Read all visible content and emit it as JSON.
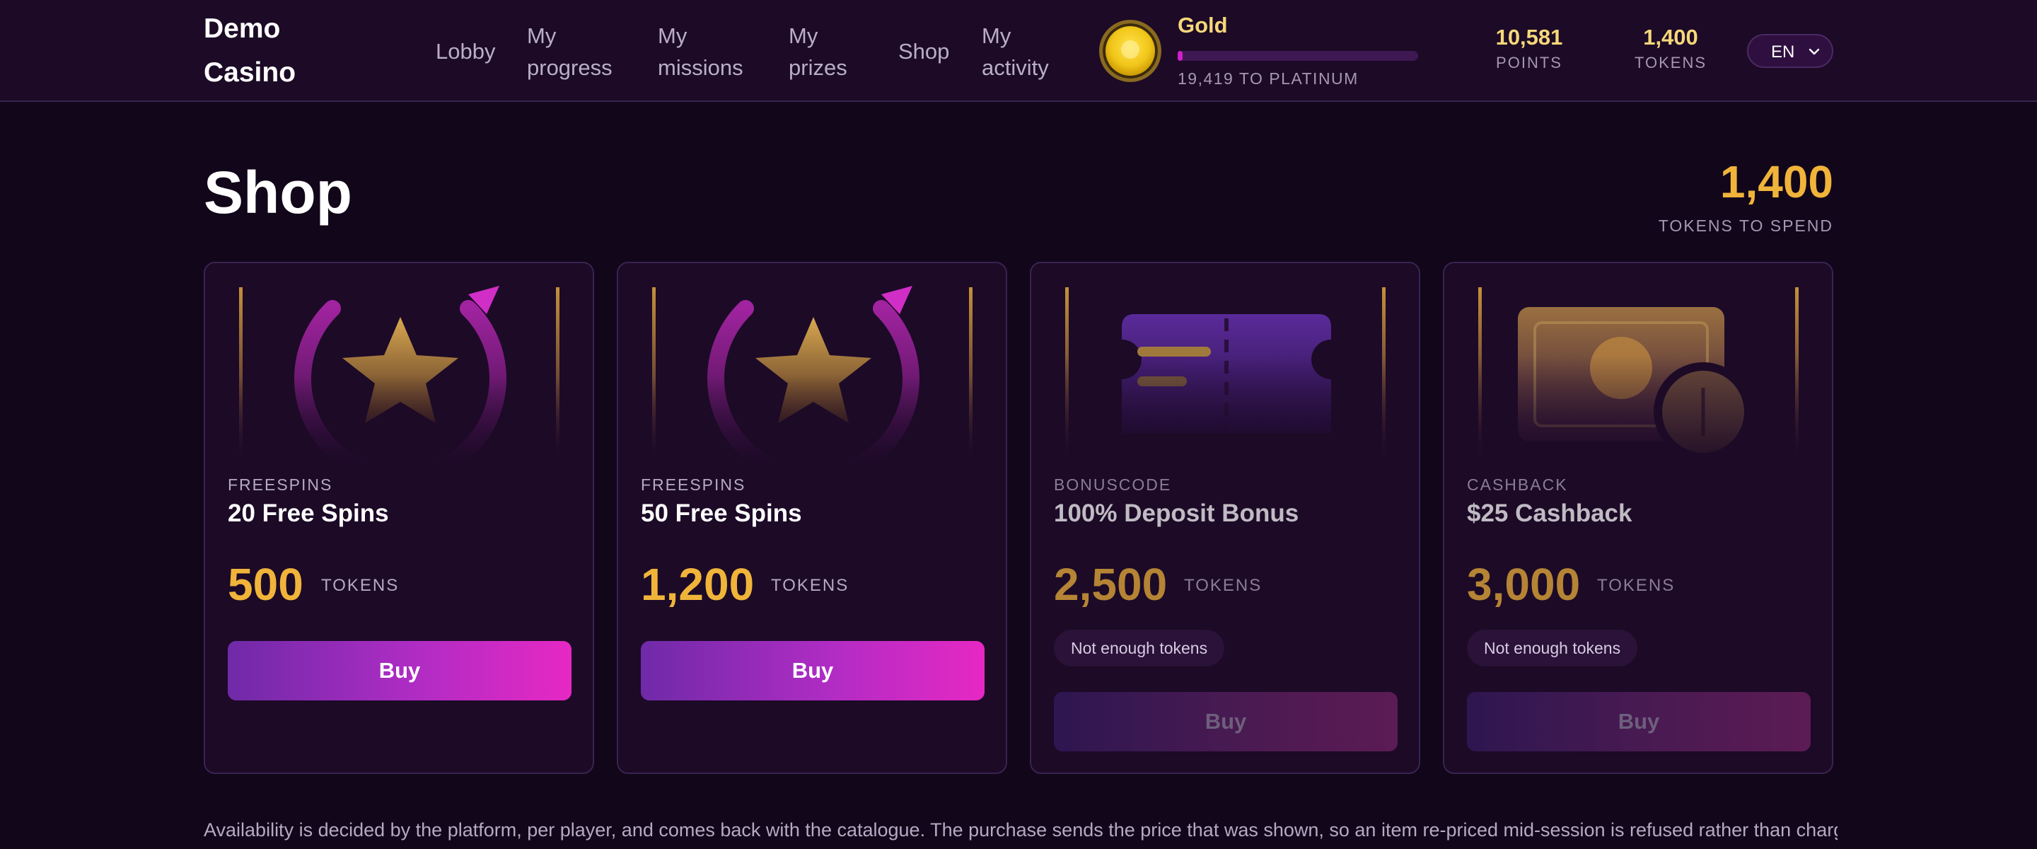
{
  "header": {
    "brand": "Demo Casino",
    "nav": [
      "Lobby",
      "My progress",
      "My missions",
      "My prizes",
      "Shop",
      "My activity"
    ],
    "tier": {
      "name": "Gold",
      "caption": "19,419 TO PLATINUM",
      "progress": 0.02
    },
    "stats": [
      {
        "value": "10,581",
        "label": "POINTS"
      },
      {
        "value": "1,400",
        "label": "TOKENS"
      }
    ],
    "language": "EN"
  },
  "page": {
    "title": "Shop",
    "balance": "1,400",
    "balance_label": "TOKENS TO SPEND"
  },
  "cards": [
    {
      "category": "FREESPINS",
      "title": "20 Free Spins",
      "price": "500",
      "unit": "TOKENS",
      "button": "Buy",
      "affordable": true,
      "art": "spins"
    },
    {
      "category": "FREESPINS",
      "title": "50 Free Spins",
      "price": "1,200",
      "unit": "TOKENS",
      "button": "Buy",
      "affordable": true,
      "art": "spins"
    },
    {
      "category": "BONUSCODE",
      "title": "100% Deposit Bonus",
      "price": "2,500",
      "unit": "TOKENS",
      "button": "Buy",
      "affordable": false,
      "notice": "Not enough tokens",
      "art": "ticket"
    },
    {
      "category": "CASHBACK",
      "title": "$25 Cashback",
      "price": "3,000",
      "unit": "TOKENS",
      "button": "Buy",
      "affordable": false,
      "notice": "Not enough tokens",
      "art": "cash"
    }
  ],
  "footer": "Availability is decided by the platform, per player, and comes back with the catalogue. The purchase sends the price that was shown, so an item re-priced mid-session is refused rather than charged at",
  "colors": {
    "background": "#12061a",
    "header": "#1c0a26",
    "card": "#1c0a27",
    "gold": "#f0b43a",
    "accent": "#e728c4",
    "accent_start": "#6f2aa8"
  }
}
